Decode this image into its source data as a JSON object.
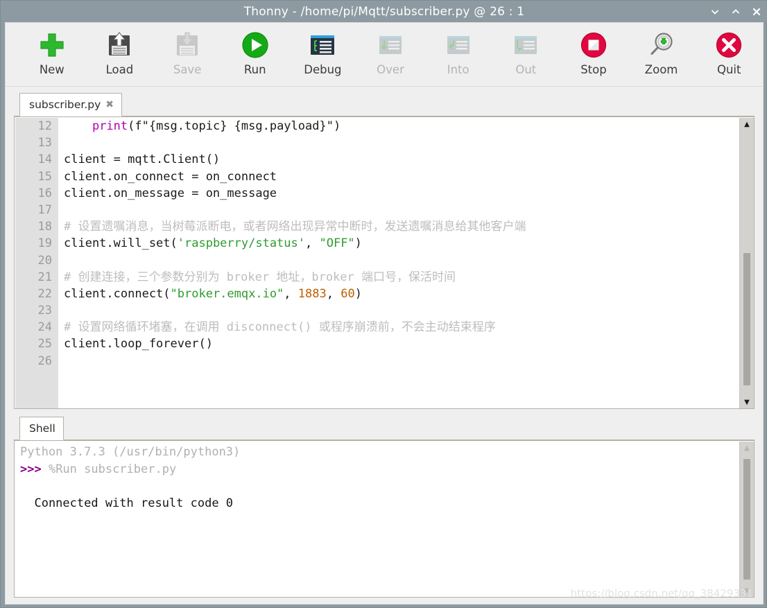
{
  "window": {
    "title": "Thonny  -  /home/pi/Mqtt/subscriber.py  @  26 : 1",
    "controls": [
      {
        "name": "minimize",
        "glyph": "⌄"
      },
      {
        "name": "maximize",
        "glyph": "⌃"
      },
      {
        "name": "close",
        "glyph": "✕"
      }
    ],
    "titlebar_color": "#8d9aa1"
  },
  "toolbar": {
    "buttons": [
      {
        "label": "New",
        "icon": "plus-icon",
        "enabled": true
      },
      {
        "label": "Load",
        "icon": "floppy-up-icon",
        "enabled": true
      },
      {
        "label": "Save",
        "icon": "floppy-down-icon",
        "enabled": false
      },
      {
        "label": "Run",
        "icon": "play-circle-icon",
        "enabled": true
      },
      {
        "label": "Debug",
        "icon": "debug-window-icon",
        "enabled": true
      },
      {
        "label": "Over",
        "icon": "step-over-icon",
        "enabled": false
      },
      {
        "label": "Into",
        "icon": "step-into-icon",
        "enabled": false
      },
      {
        "label": "Out",
        "icon": "step-out-icon",
        "enabled": false
      },
      {
        "label": "Stop",
        "icon": "stop-circle-icon",
        "enabled": true
      },
      {
        "label": "Zoom",
        "icon": "magnifier-plus-icon",
        "enabled": true
      },
      {
        "label": "Quit",
        "icon": "close-circle-icon",
        "enabled": true
      }
    ],
    "colors": {
      "green": "#2eb82e",
      "red": "#e00840",
      "disabled": "#b4b4b4"
    }
  },
  "editor": {
    "tab": {
      "label": "subscriber.py",
      "close_glyph": "✖"
    },
    "first_line_number": 12,
    "lines": [
      {
        "n": 12,
        "tokens": [
          {
            "t": "    ",
            "c": "pl"
          },
          {
            "t": "print",
            "c": "kw"
          },
          {
            "t": "(f\"{msg.topic} {msg.payload}\")",
            "c": "pl"
          }
        ]
      },
      {
        "n": 13,
        "tokens": []
      },
      {
        "n": 14,
        "tokens": [
          {
            "t": "client = mqtt.Client()",
            "c": "pl"
          }
        ]
      },
      {
        "n": 15,
        "tokens": [
          {
            "t": "client.on_connect = on_connect",
            "c": "pl"
          }
        ]
      },
      {
        "n": 16,
        "tokens": [
          {
            "t": "client.on_message = on_message",
            "c": "pl"
          }
        ]
      },
      {
        "n": 17,
        "tokens": []
      },
      {
        "n": 18,
        "tokens": [
          {
            "t": "# 设置遗嘱消息，当树莓派断电，或者网络出现异常中断时，发送遗嘱消息给其他客户端",
            "c": "com"
          }
        ]
      },
      {
        "n": 19,
        "tokens": [
          {
            "t": "client.will_set(",
            "c": "pl"
          },
          {
            "t": "'raspberry/status'",
            "c": "str"
          },
          {
            "t": ", ",
            "c": "pl"
          },
          {
            "t": "\"OFF\"",
            "c": "str"
          },
          {
            "t": ")",
            "c": "pl"
          }
        ]
      },
      {
        "n": 20,
        "tokens": []
      },
      {
        "n": 21,
        "tokens": [
          {
            "t": "# 创建连接，三个参数分别为 broker 地址，broker 端口号，保活时间",
            "c": "com"
          }
        ]
      },
      {
        "n": 22,
        "tokens": [
          {
            "t": "client.connect(",
            "c": "pl"
          },
          {
            "t": "\"broker.emqx.io\"",
            "c": "str"
          },
          {
            "t": ", ",
            "c": "pl"
          },
          {
            "t": "1883",
            "c": "num"
          },
          {
            "t": ", ",
            "c": "pl"
          },
          {
            "t": "60",
            "c": "num"
          },
          {
            "t": ")",
            "c": "pl"
          }
        ]
      },
      {
        "n": 23,
        "tokens": []
      },
      {
        "n": 24,
        "tokens": [
          {
            "t": "# 设置网络循环堵塞，在调用 disconnect() 或程序崩溃前，不会主动结束程序",
            "c": "com"
          }
        ]
      },
      {
        "n": 25,
        "tokens": [
          {
            "t": "client.loop_forever()",
            "c": "pl"
          }
        ]
      },
      {
        "n": 26,
        "tokens": []
      }
    ],
    "scrollbar": {
      "thumb_top_pct": 46,
      "thumb_height_pct": 50
    }
  },
  "shell": {
    "tab": {
      "label": "Shell"
    },
    "lines": [
      {
        "segments": [
          {
            "t": "Python 3.7.3 (/usr/bin/python3)",
            "c": "grey"
          }
        ]
      },
      {
        "segments": [
          {
            "t": ">>> ",
            "c": "prompt"
          },
          {
            "t": "%Run subscriber.py",
            "c": "grey"
          }
        ]
      },
      {
        "segments": [
          {
            "t": "",
            "c": "grey"
          }
        ]
      },
      {
        "segments": [
          {
            "t": "  Connected with result code 0",
            "c": "out"
          }
        ]
      }
    ],
    "scrollbar": {
      "thumb_top_pct": 3,
      "thumb_height_pct": 93
    }
  },
  "watermark": {
    "text": "https://blog.csdn.net/qq_38429331"
  },
  "syntax_colors": {
    "keyword": "#b000b0",
    "string": "#2e9b2e",
    "number": "#c06000",
    "comment": "#bdbdbd",
    "plain": "#1a1a1a"
  }
}
